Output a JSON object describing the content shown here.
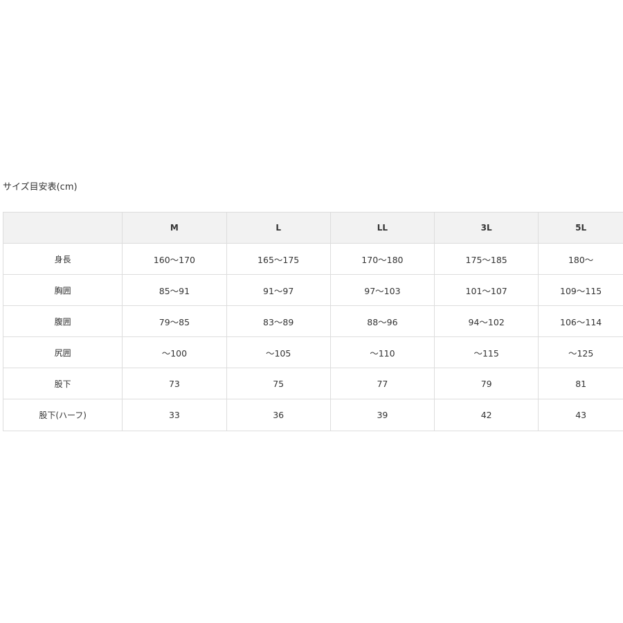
{
  "caption": "サイズ目安表(cm)",
  "table": {
    "headers": [
      "",
      "M",
      "L",
      "LL",
      "3L",
      "5L"
    ],
    "rows": [
      [
        "身長",
        "160〜170",
        "165〜175",
        "170〜180",
        "175〜185",
        "180〜"
      ],
      [
        "胸囲",
        "85〜91",
        "91〜97",
        "97〜103",
        "101〜107",
        "109〜115"
      ],
      [
        "腹囲",
        "79〜85",
        "83〜89",
        "88〜96",
        "94〜102",
        "106〜114"
      ],
      [
        "尻囲",
        "〜100",
        "〜105",
        "〜110",
        "〜115",
        "〜125"
      ],
      [
        "股下",
        "73",
        "75",
        "77",
        "79",
        "81"
      ],
      [
        "股下(ハーフ)",
        "33",
        "36",
        "39",
        "42",
        "43"
      ]
    ]
  }
}
